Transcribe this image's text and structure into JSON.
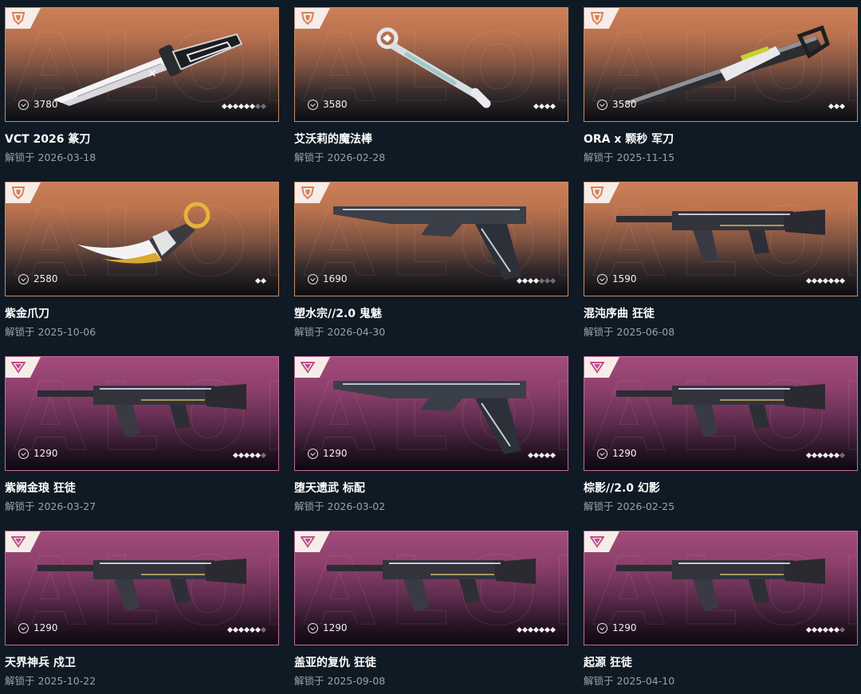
{
  "unlock_prefix": "解锁于",
  "items": [
    {
      "tier": "orange",
      "price": "3780",
      "stars": 6,
      "stars_total": 8,
      "title": "VCT 2026 篆刀",
      "date": "2026-03-18",
      "weapon_icon": "knife-icon"
    },
    {
      "tier": "orange",
      "price": "3580",
      "stars": 4,
      "stars_total": 4,
      "title": "艾沃莉的魔法棒",
      "date": "2026-02-28",
      "weapon_icon": "wand-icon"
    },
    {
      "tier": "orange",
      "price": "3580",
      "stars": 3,
      "stars_total": 3,
      "title": "ORA x 颗秒 军刀",
      "date": "2025-11-15",
      "weapon_icon": "blade-icon"
    },
    {
      "tier": "orange",
      "price": "2580",
      "stars": 2,
      "stars_total": 2,
      "title": "紫金爪刀",
      "date": "2025-10-06",
      "weapon_icon": "karambit-icon"
    },
    {
      "tier": "orange",
      "price": "1690",
      "stars": 4,
      "stars_total": 7,
      "title": "塑水宗//2.0 鬼魅",
      "date": "2026-04-30",
      "weapon_icon": "pistol-icon"
    },
    {
      "tier": "orange",
      "price": "1590",
      "stars": 7,
      "stars_total": 7,
      "title": "混沌序曲 狂徒",
      "date": "2025-06-08",
      "weapon_icon": "rifle-icon"
    },
    {
      "tier": "pink",
      "price": "1290",
      "stars": 5,
      "stars_total": 6,
      "title": "紫阙金琅 狂徒",
      "date": "2026-03-27",
      "weapon_icon": "rifle-icon"
    },
    {
      "tier": "pink",
      "price": "1290",
      "stars": 5,
      "stars_total": 5,
      "title": "堕天遗武 标配",
      "date": "2026-03-02",
      "weapon_icon": "pistol-icon"
    },
    {
      "tier": "pink",
      "price": "1290",
      "stars": 6,
      "stars_total": 7,
      "title": "棕影//2.0 幻影",
      "date": "2026-02-25",
      "weapon_icon": "rifle-icon"
    },
    {
      "tier": "pink",
      "price": "1290",
      "stars": 6,
      "stars_total": 7,
      "title": "天界神兵 戍卫",
      "date": "2025-10-22",
      "weapon_icon": "rifle-icon"
    },
    {
      "tier": "pink",
      "price": "1290",
      "stars": 7,
      "stars_total": 7,
      "title": "盖亚的复仇 狂徒",
      "date": "2025-09-08",
      "weapon_icon": "rifle-icon"
    },
    {
      "tier": "pink",
      "price": "1290",
      "stars": 6,
      "stars_total": 7,
      "title": "起源 狂徒",
      "date": "2025-04-10",
      "weapon_icon": "rifle-icon"
    }
  ],
  "colors": {
    "orange_tier": "#cc8057",
    "pink_tier": "#a34b7b",
    "background": "#0f1a24"
  }
}
